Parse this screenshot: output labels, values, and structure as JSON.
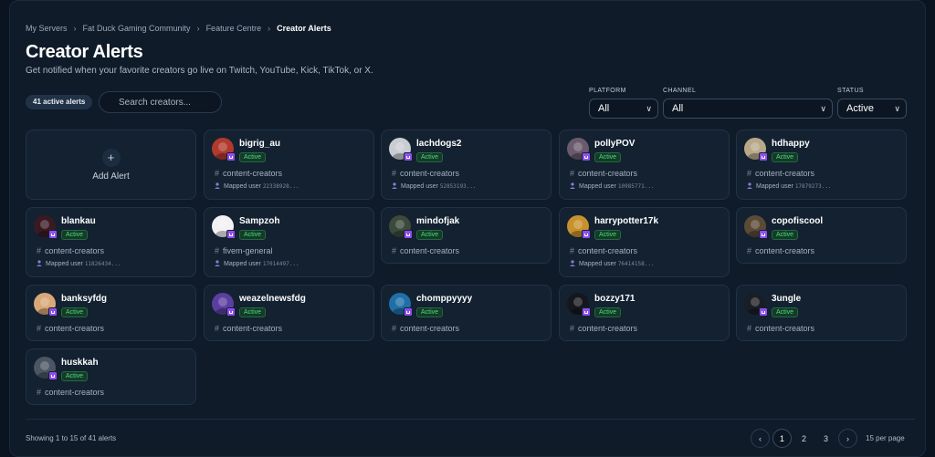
{
  "breadcrumb": [
    "My Servers",
    "Fat Duck Gaming Community",
    "Feature Centre",
    "Creator Alerts"
  ],
  "title": "Creator Alerts",
  "subtitle": "Get notified when your favorite creators go live on Twitch, YouTube, Kick, TikTok, or X.",
  "active_count": "41 active alerts",
  "search": {
    "placeholder": "Search creators..."
  },
  "filters": {
    "platform": {
      "label": "PLATFORM",
      "value": "All"
    },
    "channel": {
      "label": "CHANNEL",
      "value": "All"
    },
    "status": {
      "label": "STATUS",
      "value": "Active"
    }
  },
  "add_alert": {
    "icon": "+",
    "label": "Add Alert"
  },
  "mapped_label": "Mapped user",
  "cards": [
    {
      "name": "bigrig_au",
      "status": "Active",
      "channel": "content-creators",
      "mapped_id": "22338928...",
      "avatar": "#b03a2e"
    },
    {
      "name": "lachdogs2",
      "status": "Active",
      "channel": "content-creators",
      "mapped_id": "52853193...",
      "avatar": "#c9ccd2"
    },
    {
      "name": "pollyPOV",
      "status": "Active",
      "channel": "content-creators",
      "mapped_id": "10985771...",
      "avatar": "#6b5a6e"
    },
    {
      "name": "hdhappy",
      "status": "Active",
      "channel": "content-creators",
      "mapped_id": "17879273...",
      "avatar": "#b8a88a"
    },
    {
      "name": "blankau",
      "status": "Active",
      "channel": "content-creators",
      "mapped_id": "11826434...",
      "avatar": "#3a1a22"
    },
    {
      "name": "Sampzoh",
      "status": "Active",
      "channel": "fivem-general",
      "mapped_id": "17014497...",
      "avatar": "#f2f2f2"
    },
    {
      "name": "mindofjak",
      "status": "Active",
      "channel": "content-creators",
      "mapped_id": "",
      "avatar": "#3b4a3a"
    },
    {
      "name": "harrypotter17k",
      "status": "Active",
      "channel": "content-creators",
      "mapped_id": "76414158...",
      "avatar": "#c7922e"
    },
    {
      "name": "copofiscool",
      "status": "Active",
      "channel": "content-creators",
      "mapped_id": "",
      "avatar": "#5a4a36"
    },
    {
      "name": "banksyfdg",
      "status": "Active",
      "channel": "content-creators",
      "mapped_id": "",
      "avatar": "#d9a877"
    },
    {
      "name": "weazelnewsfdg",
      "status": "Active",
      "channel": "content-creators",
      "mapped_id": "",
      "avatar": "#5b3fa0"
    },
    {
      "name": "chomppyyyy",
      "status": "Active",
      "channel": "content-creators",
      "mapped_id": "",
      "avatar": "#1f6fa8"
    },
    {
      "name": "bozzy171",
      "status": "Active",
      "channel": "content-creators",
      "mapped_id": "",
      "avatar": "#15171c"
    },
    {
      "name": "3ungle",
      "status": "Active",
      "channel": "content-creators",
      "mapped_id": "",
      "avatar": "#1a1d24"
    },
    {
      "name": "huskkah",
      "status": "Active",
      "channel": "content-creators",
      "mapped_id": "",
      "avatar": "#4b5563"
    }
  ],
  "footer": {
    "showing": "Showing 1 to 15 of 41 alerts",
    "pages": [
      "1",
      "2",
      "3"
    ],
    "current_page": "1",
    "per_page": "15 per page"
  },
  "colors": {
    "accent_active": "#4ade80",
    "twitch": "#8f4ff0",
    "background": "#0f1b29"
  }
}
